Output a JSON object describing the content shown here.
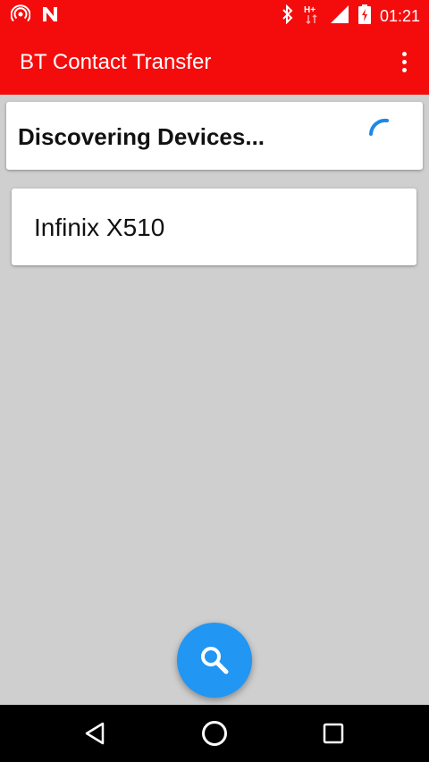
{
  "status_bar": {
    "time": "01:21",
    "icons": [
      "hotspot-icon",
      "notification-n-icon",
      "bluetooth-icon",
      "hplus-data-icon",
      "signal-icon",
      "battery-icon"
    ]
  },
  "app_bar": {
    "title": "BT Contact Transfer",
    "menu_icon": "more-vert-icon"
  },
  "status_card": {
    "text": "Discovering Devices...",
    "spinner": "progress-spinner-icon"
  },
  "devices": [
    {
      "name": "Infinix X510"
    }
  ],
  "fab": {
    "icon": "search-icon"
  },
  "nav_bar": {
    "icons": [
      "back-icon",
      "home-icon",
      "recents-icon"
    ]
  },
  "colors": {
    "primary": "#f40c0c",
    "accent": "#2196f3",
    "background": "#cfcfcf"
  }
}
